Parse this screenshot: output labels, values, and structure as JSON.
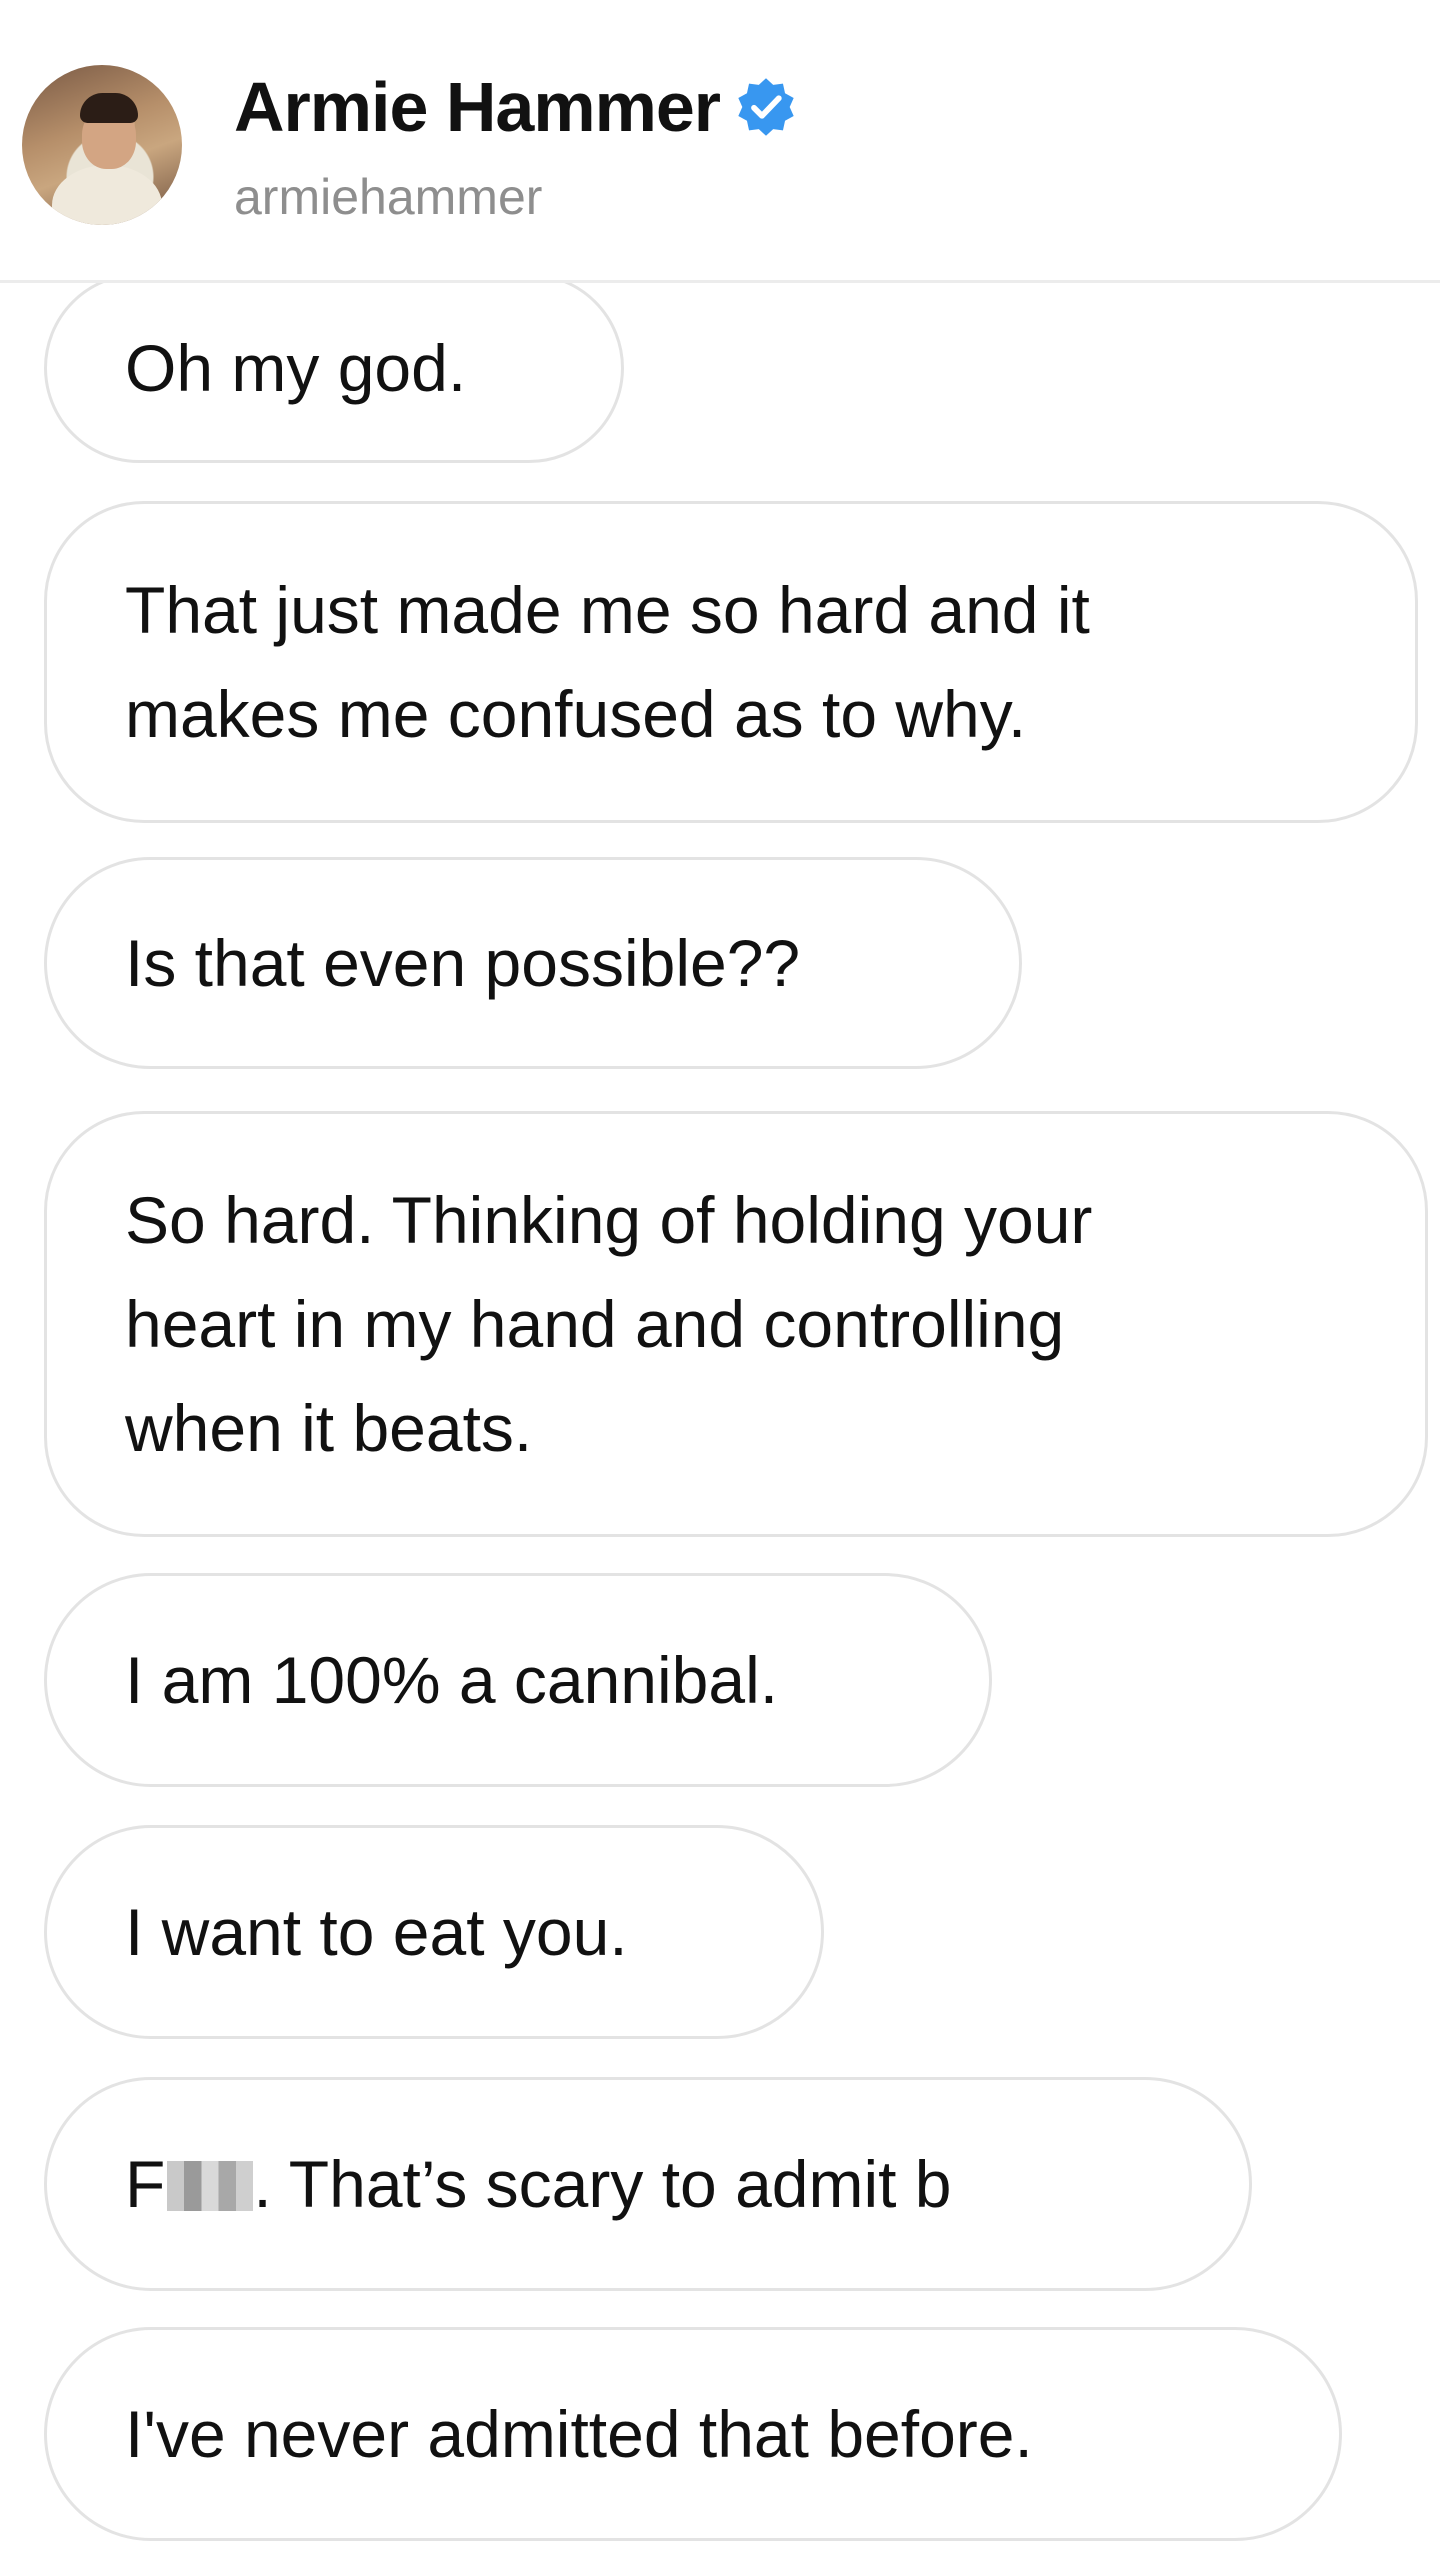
{
  "header": {
    "display_name": "Armie Hammer",
    "username": "armiehammer",
    "verified_icon": "verified-badge-icon",
    "accent_color": "#3897f0"
  },
  "messages": [
    {
      "text": "Oh my god."
    },
    {
      "text": "That just made me so hard and it\nmakes me confused as to why."
    },
    {
      "text": "Is that even possible??"
    },
    {
      "text": "So hard. Thinking of holding your\nheart in my hand and controlling\nwhen it beats."
    },
    {
      "text": "I am 100% a cannibal."
    },
    {
      "text": "I want to eat you."
    },
    {
      "prefix": "F",
      "text": ". That’s scary to admit b"
    },
    {
      "text": "I've never admitted that before."
    }
  ]
}
